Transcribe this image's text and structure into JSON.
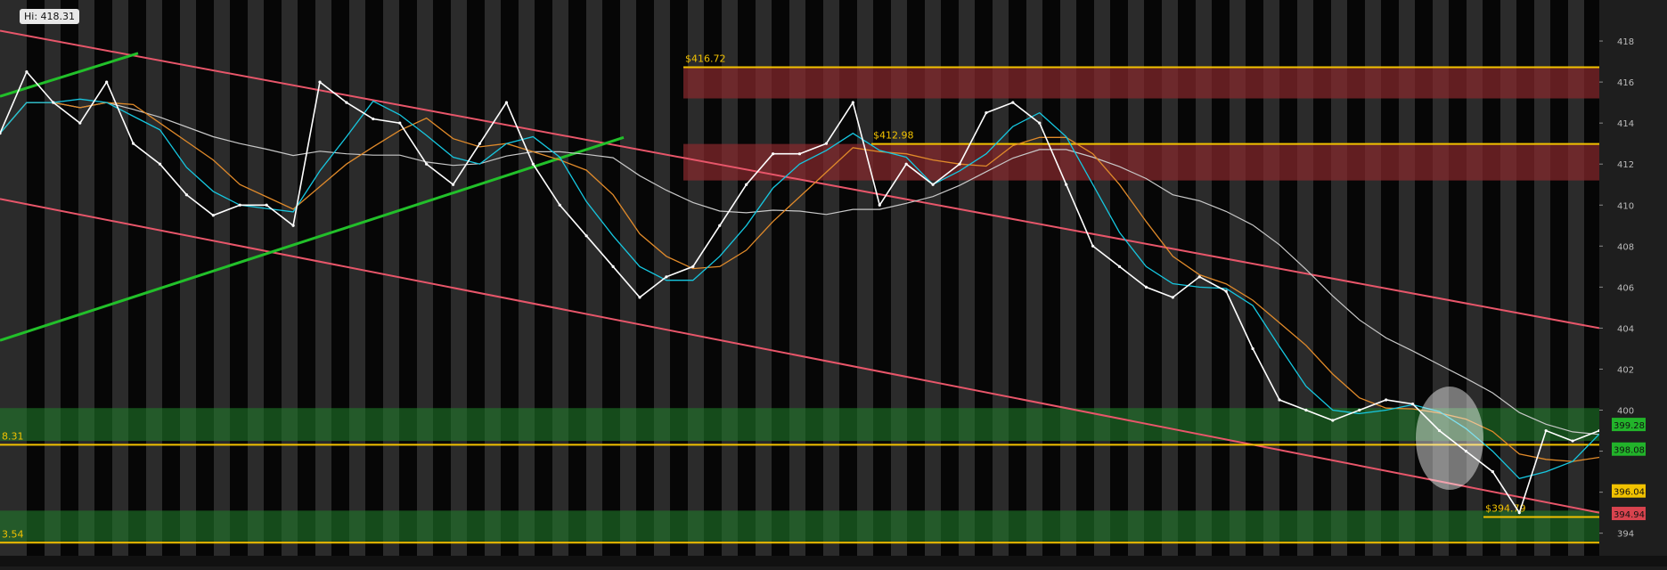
{
  "hi_label": "Hi: 418.31",
  "chart_data": {
    "type": "line",
    "title": "",
    "xlabel": "",
    "ylabel": "",
    "ylim": [
      392.9,
      420
    ],
    "y_ticks": [
      394,
      396,
      398,
      400,
      402,
      404,
      406,
      408,
      410,
      412,
      414,
      416,
      418,
      420
    ],
    "grid": "vertical session bands",
    "colors": {
      "background": "#2b2b2b",
      "session_band_dark": "#000000",
      "channel": "#e8566a",
      "trend_up": "#22c02a",
      "level_line": "#f2c200",
      "supply_zone": "#8a2a2e",
      "demand_zone": "#1f7a2a",
      "price": "#ffffff",
      "ma_fast": "#16c7e0",
      "ma_mid": "#e08a2a",
      "ma_slow": "#c8c8c8"
    },
    "series": [
      {
        "name": "",
        "x": [
          0,
          10,
          20,
          30,
          40,
          50,
          60,
          70,
          80,
          90,
          100,
          110,
          120,
          130,
          140,
          150,
          160,
          170,
          180,
          190,
          200,
          210,
          220,
          230,
          240,
          250,
          260,
          270,
          280,
          290,
          300,
          310,
          320,
          330,
          340,
          350,
          360,
          370,
          380,
          390,
          400,
          410,
          420,
          430,
          440,
          450,
          460,
          470,
          480,
          490,
          500,
          510,
          520,
          530,
          540,
          550,
          560,
          570,
          580,
          590,
          600
        ],
        "values": [
          413.5,
          416.5,
          415,
          414,
          416,
          413,
          412,
          410.5,
          409.5,
          410,
          410,
          409,
          416,
          415,
          414.2,
          414,
          412,
          411,
          413,
          415,
          412,
          410,
          408.5,
          407,
          405.5,
          406.5,
          407,
          409,
          411,
          412.5,
          412.5,
          413,
          415,
          410,
          412,
          411,
          412,
          414.5,
          415,
          414,
          411,
          408,
          407,
          406,
          405.5,
          406.5,
          405.8,
          403,
          400.5,
          400,
          399.5,
          400,
          400.5,
          400.3,
          399,
          398,
          397,
          395,
          399,
          398.5,
          399
        ]
      }
    ],
    "levels": [
      {
        "value": 416.72,
        "label": "$416.72"
      },
      {
        "value": 412.98,
        "label": "$412.98"
      },
      {
        "value": 398.31,
        "label": "8.31"
      },
      {
        "value": 394.79,
        "label": "$394.79"
      },
      {
        "value": 393.54,
        "label": "3.54"
      }
    ],
    "price_tags": [
      {
        "value": 399.28,
        "label": "399.28",
        "color": "#22b32a"
      },
      {
        "value": 398.08,
        "label": "398.08",
        "color": "#22b32a"
      },
      {
        "value": 396.04,
        "label": "396.04",
        "color": "#f2c200"
      },
      {
        "value": 394.94,
        "label": "394.94",
        "color": "#d8434e"
      }
    ],
    "zones": [
      {
        "kind": "supply",
        "from": 415.2,
        "to": 416.72
      },
      {
        "kind": "supply",
        "from": 411.2,
        "to": 412.98
      },
      {
        "kind": "demand",
        "from": 398.5,
        "to": 400.1
      },
      {
        "kind": "demand",
        "from": 393.6,
        "to": 395.1
      }
    ]
  }
}
